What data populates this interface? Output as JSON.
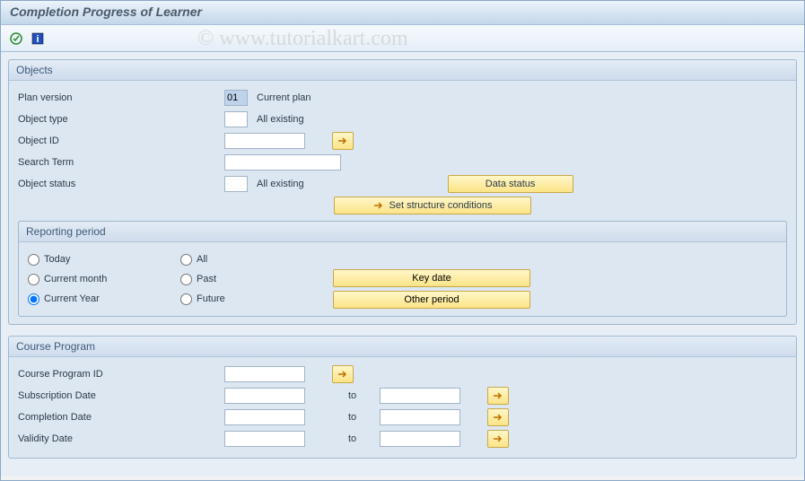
{
  "window": {
    "title": "Completion Progress of Learner"
  },
  "watermark": "© www.tutorialkart.com",
  "objects": {
    "title": "Objects",
    "plan_version_label": "Plan version",
    "plan_version_value": "01",
    "plan_version_text": "Current plan",
    "object_type_label": "Object type",
    "object_type_value": "",
    "object_type_text": "All existing",
    "object_id_label": "Object ID",
    "search_term_label": "Search Term",
    "object_status_label": "Object status",
    "object_status_value": "",
    "object_status_text": "All existing",
    "data_status_btn": "Data status",
    "set_structure_btn": "Set structure conditions"
  },
  "reporting": {
    "title": "Reporting period",
    "today": "Today",
    "current_month": "Current month",
    "current_year": "Current Year",
    "all": "All",
    "past": "Past",
    "future": "Future",
    "key_date_btn": "Key date",
    "other_period_btn": "Other period"
  },
  "course": {
    "title": "Course Program",
    "program_id_label": "Course Program ID",
    "subscription_label": "Subscription Date",
    "completion_label": "Completion Date",
    "validity_label": "Validity Date",
    "to": "to"
  }
}
